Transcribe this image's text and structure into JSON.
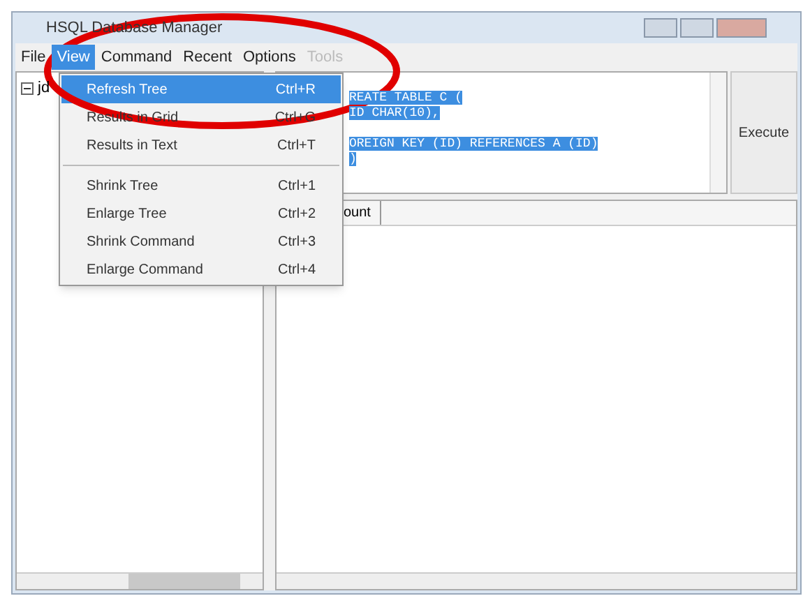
{
  "window": {
    "title": "HSQL Database Manager"
  },
  "menu_bar": [
    {
      "label": "File",
      "selected": false,
      "disabled": false
    },
    {
      "label": "View",
      "selected": true,
      "disabled": false
    },
    {
      "label": "Command",
      "selected": false,
      "disabled": false
    },
    {
      "label": "Recent",
      "selected": false,
      "disabled": false
    },
    {
      "label": "Options",
      "selected": false,
      "disabled": false
    },
    {
      "label": "Tools",
      "selected": false,
      "disabled": true
    }
  ],
  "view_menu": [
    {
      "kind": "item",
      "label": "Refresh Tree",
      "shortcut": "Ctrl+R",
      "selected": true
    },
    {
      "kind": "item",
      "label": "Results in Grid",
      "shortcut": "Ctrl+G",
      "selected": false
    },
    {
      "kind": "item",
      "label": "Results in Text",
      "shortcut": "Ctrl+T",
      "selected": false
    },
    {
      "kind": "separator"
    },
    {
      "kind": "item",
      "label": "Shrink Tree",
      "shortcut": "Ctrl+1",
      "selected": false
    },
    {
      "kind": "item",
      "label": "Enlarge Tree",
      "shortcut": "Ctrl+2",
      "selected": false
    },
    {
      "kind": "item",
      "label": "Shrink Command",
      "shortcut": "Ctrl+3",
      "selected": false
    },
    {
      "kind": "item",
      "label": "Enlarge Command",
      "shortcut": "Ctrl+4",
      "selected": false
    }
  ],
  "tree": [
    {
      "label": "jd",
      "expanded": true
    }
  ],
  "command": {
    "blocks": [
      [
        "REATE TABLE C (",
        "ID CHAR(10),"
      ],
      [
        "OREIGN KEY (ID) REFERENCES A (ID)",
        ")"
      ]
    ]
  },
  "execute_button": "Execute",
  "results": {
    "columns": [
      "ount"
    ]
  }
}
